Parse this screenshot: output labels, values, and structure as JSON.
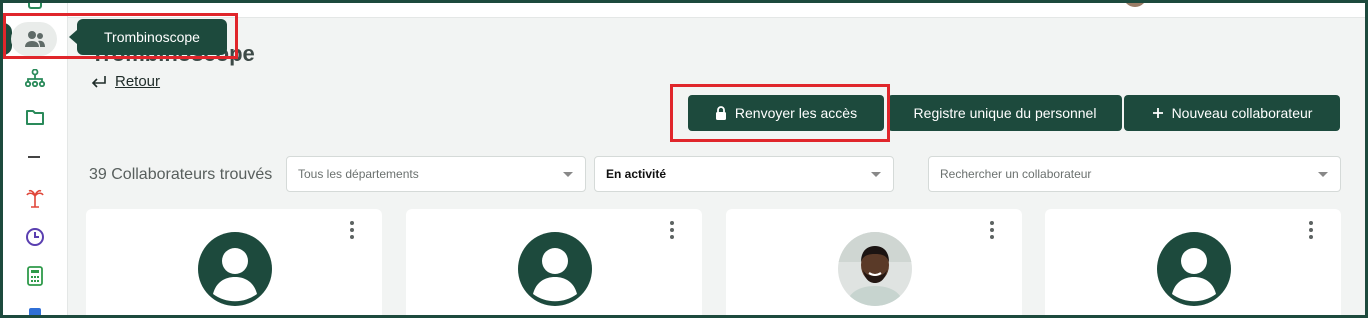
{
  "tooltip": {
    "label": "Trombinoscope"
  },
  "page": {
    "title": "Trombinoscope",
    "back_label": "Retour"
  },
  "actions": {
    "resend_access": "Renvoyer les accès",
    "register": "Registre unique du personnel",
    "new_collaborator": "Nouveau collaborateur"
  },
  "filters": {
    "count_text": "39 Collaborateurs trouvés",
    "department_placeholder": "Tous les départements",
    "status_value": "En activité",
    "search_placeholder": "Rechercher un collaborateur"
  },
  "sidebar": {
    "items": [
      {
        "icon": "people-icon",
        "color": "#5f6b68"
      },
      {
        "icon": "org-chart-icon",
        "color": "#2a8a5a"
      },
      {
        "icon": "folder-icon",
        "color": "#2a8a5a"
      },
      {
        "icon": "minus-icon",
        "color": "#444444"
      },
      {
        "icon": "palm-tree-icon",
        "color": "#e0473a"
      },
      {
        "icon": "clock-icon",
        "color": "#5a3fb0"
      },
      {
        "icon": "calculator-icon",
        "color": "#2f9a4a"
      },
      {
        "icon": "document-icon",
        "color": "#2f6fd6"
      }
    ]
  },
  "cards": [
    {
      "avatar": "default-avatar-icon"
    },
    {
      "avatar": "default-avatar-icon"
    },
    {
      "avatar": "photo-avatar"
    },
    {
      "avatar": "default-avatar-icon"
    }
  ],
  "colors": {
    "primary": "#1d4a3d",
    "highlight": "#e0262b",
    "background": "#f2f4f3"
  }
}
